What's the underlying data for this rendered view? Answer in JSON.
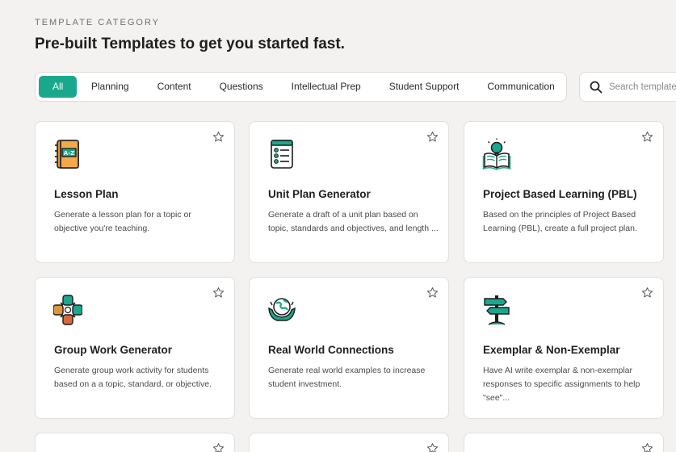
{
  "header": {
    "eyebrow": "TEMPLATE CATEGORY",
    "title": "Pre-built Templates to get you started fast."
  },
  "tabs": [
    {
      "label": "All",
      "active": true
    },
    {
      "label": "Planning"
    },
    {
      "label": "Content"
    },
    {
      "label": "Questions"
    },
    {
      "label": "Intellectual Prep"
    },
    {
      "label": "Student Support"
    },
    {
      "label": "Communication"
    }
  ],
  "tabs_more_glyph": "›",
  "search": {
    "placeholder": "Search templates"
  },
  "accent_color": "#1aa88d",
  "cards": [
    {
      "title": "Lesson Plan",
      "description": "Generate a lesson plan for a topic or objective you're teaching.",
      "icon": "a-z-notebook-icon"
    },
    {
      "title": "Unit Plan Generator",
      "description": "Generate a draft of a unit plan based on topic, standards and objectives, and length ...",
      "icon": "checklist-icon"
    },
    {
      "title": "Project Based Learning (PBL)",
      "description": "Based on the principles of Project Based Learning (PBL), create a full project plan.",
      "icon": "lightbulb-book-icon"
    },
    {
      "title": "Group Work Generator",
      "description": "Generate group work activity for students based on a a topic, standard, or objective.",
      "icon": "group-hands-icon"
    },
    {
      "title": "Real World Connections",
      "description": "Generate real world examples to increase student investment.",
      "icon": "globe-hands-icon"
    },
    {
      "title": "Exemplar & Non-Exemplar",
      "description": "Have AI write exemplar & non-exemplar responses to specific assignments to help \"see\"...",
      "icon": "signpost-icon"
    }
  ]
}
